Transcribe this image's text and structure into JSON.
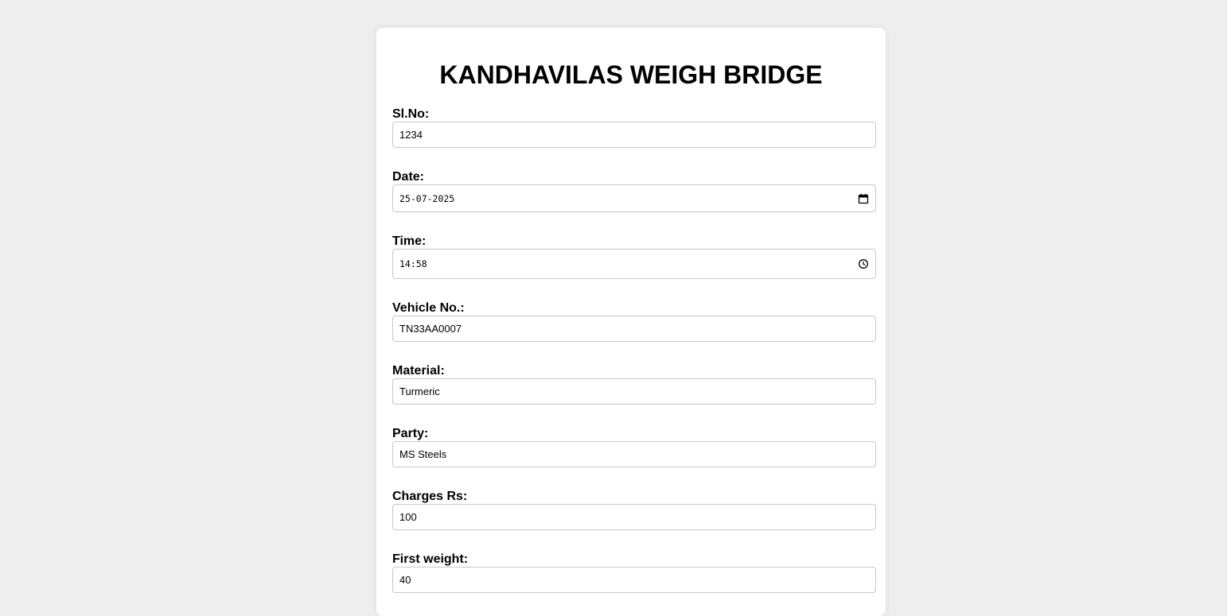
{
  "form": {
    "title": "KANDHAVILAS WEIGH BRIDGE",
    "fields": [
      {
        "label": "Sl.No:",
        "value": "1234"
      },
      {
        "label": "Date:",
        "value": "25-07-2025",
        "icon": "calendar-icon"
      },
      {
        "label": "Time:",
        "value": "14:58",
        "icon": "clock-icon"
      },
      {
        "label": "Vehicle No.:",
        "value": "TN33AA0007"
      },
      {
        "label": "Material:",
        "value": "Turmeric"
      },
      {
        "label": "Party:",
        "value": "MS Steels"
      },
      {
        "label": "Charges Rs:",
        "value": "100"
      },
      {
        "label": "First weight:",
        "value": "40"
      }
    ]
  }
}
